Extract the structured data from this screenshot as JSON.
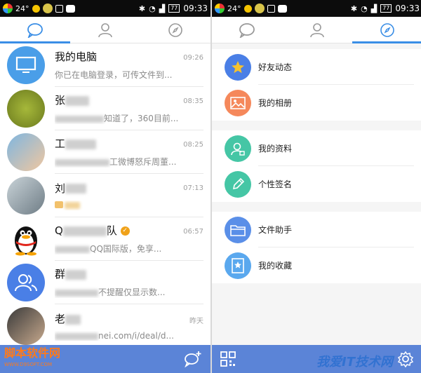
{
  "status_bar": {
    "temperature": "24°",
    "battery": "77",
    "time": "09:33"
  },
  "left_screen": {
    "conversations": [
      {
        "name": "我的电脑",
        "preview": "你已在电脑登录，可传文件到...",
        "time": "09:26"
      },
      {
        "name": "张",
        "preview": "知道了，360目前...",
        "time": "08:35"
      },
      {
        "name": "工",
        "preview": "工微博怒斥周董...",
        "time": "08:25"
      },
      {
        "name": "刘",
        "preview": "",
        "time": "07:13"
      },
      {
        "name": "Q",
        "name_suffix": "队",
        "preview": "QQ国际版，免享...",
        "time": "06:57"
      },
      {
        "name": "群",
        "preview": "不提醒仅显示数...",
        "time": ""
      },
      {
        "name": "老",
        "preview": "nei.com/i/deal/d...",
        "time": "昨天"
      }
    ],
    "watermark": {
      "title": "脚本软件网",
      "url": "WWW.D9SOFT.COM"
    }
  },
  "right_screen": {
    "groups": [
      [
        {
          "label": "好友动态",
          "icon": "star-icon",
          "color": "#4a7fe6"
        },
        {
          "label": "我的相册",
          "icon": "photo-icon",
          "color": "#f5885b"
        }
      ],
      [
        {
          "label": "我的资料",
          "icon": "profile-card-icon",
          "color": "#45c6a5"
        },
        {
          "label": "个性签名",
          "icon": "pencil-icon",
          "color": "#45c6a5"
        }
      ],
      [
        {
          "label": "文件助手",
          "icon": "folder-icon",
          "color": "#5a8fe8"
        },
        {
          "label": "我的收藏",
          "icon": "bookmark-star-icon",
          "color": "#5aa8ee"
        }
      ]
    ],
    "watermark": "我爱IT技术网"
  },
  "colors": {
    "accent": "#3a8ee6",
    "bottom_bar": "#5b84d7"
  }
}
